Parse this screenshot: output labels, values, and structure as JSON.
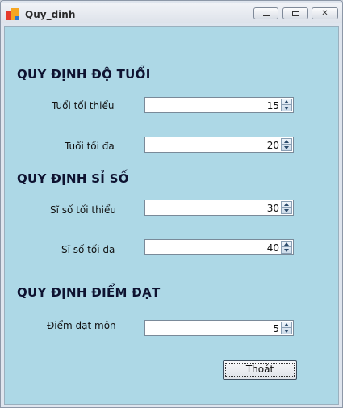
{
  "window": {
    "title": "Quy_dinh",
    "min_glyph": "_",
    "max_glyph": "□",
    "close_glyph": "✕"
  },
  "sections": {
    "age": "QUY ĐỊNH ĐỘ TUỔI",
    "class_size": "QUY ĐỊNH SỈ SỐ",
    "pass_score": "QUY ĐỊNH ĐIỂM ĐẠT"
  },
  "fields": {
    "min_age": {
      "label": "Tuổi tối thiểu",
      "value": "15"
    },
    "max_age": {
      "label": "Tuổi tối đa",
      "value": "20"
    },
    "min_size": {
      "label": "Sĩ số tối thiểu",
      "value": "30"
    },
    "max_size": {
      "label": "Sĩ số tối đa",
      "value": "40"
    },
    "pass_score": {
      "label": "Điểm đạt môn",
      "value": "5"
    }
  },
  "buttons": {
    "exit": "Thoát"
  },
  "colors": {
    "client_bg": "#add8e6",
    "heading": "#0e1230"
  }
}
